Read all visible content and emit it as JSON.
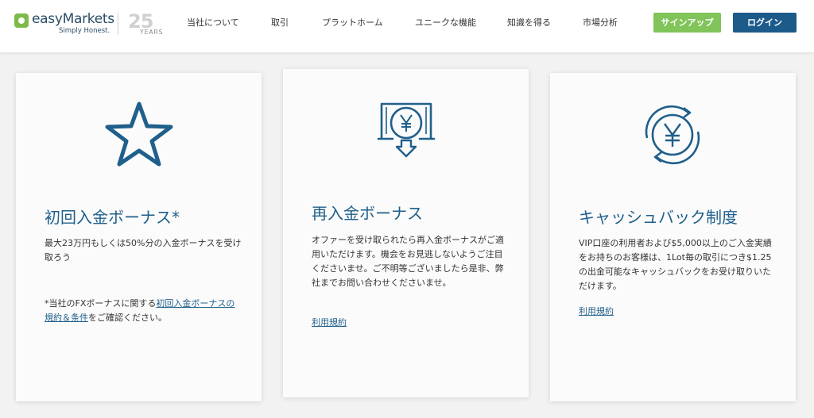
{
  "header": {
    "logo": {
      "name": "easyMarkets",
      "tagline": "Simply Honest.",
      "years_number": "25",
      "years_label": "YEARS"
    },
    "nav": [
      "当社について",
      "取引",
      "プラットホーム",
      "ユニークな機能",
      "知識を得る",
      "市場分析"
    ],
    "signup_label": "サインアップ",
    "login_label": "ログイン"
  },
  "colors": {
    "accent": "#1f5f8b",
    "signup": "#80c45a",
    "login": "#1c5a8a"
  },
  "cards": [
    {
      "icon": "star-icon",
      "title": "初回入金ボーナス*",
      "description": "最大23万円もしくは50%分の入金ボーナスを受け取ろう",
      "note_prefix": "*当社のFXボーナスに関する",
      "note_link": "初回入金ボーナスの規約＆条件",
      "note_suffix": "をご確認ください。"
    },
    {
      "icon": "yen-deposit-icon",
      "title": "再入金ボーナス",
      "description": "オファーを受け取られたら再入金ボーナスがご適用いただけます。機会をお見逃しないようご注目くださいませ。ご不明等ございましたら是非、弊社までお問い合わせくださいませ。",
      "link": "利用規約"
    },
    {
      "icon": "yen-cashback-icon",
      "title": "キャッシュバック制度",
      "description": "VIP口座の利用者および$5,000以上のご入金実績をお持ちのお客様は、1Lot毎の取引につき$1.25の出金可能なキャッシュバックをお受け取りいただけます。",
      "link": "利用規約"
    }
  ]
}
